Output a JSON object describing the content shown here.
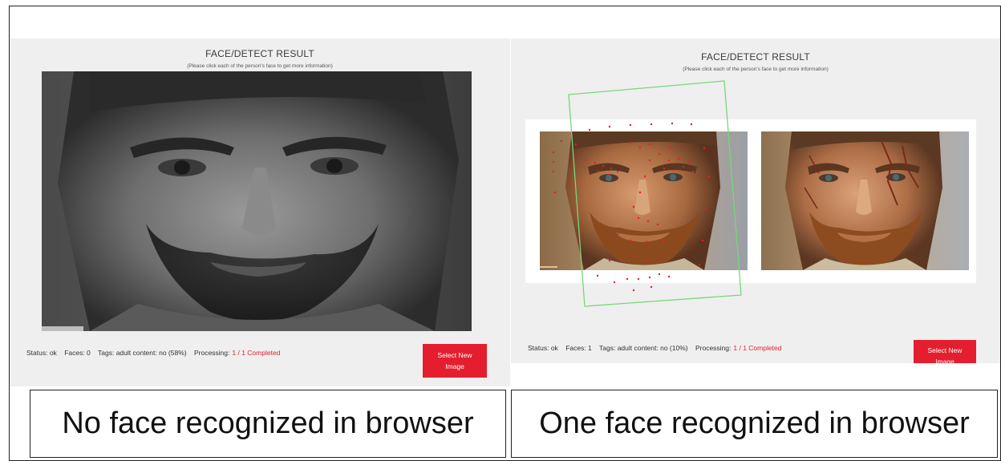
{
  "left_panel": {
    "title": "FACE/DETECT RESULT",
    "subtitle": "(Please click each of the person's face to get more information)",
    "status": "Status: ok",
    "faces": "Faces: 0",
    "tags": "Tags: adult content: no (58%)",
    "processing_label": "Processing:",
    "processing_value": "1 / 1 Completed",
    "button_label": "Select New Image"
  },
  "right_panel": {
    "title": "FACE/DETECT RESULT",
    "subtitle": "(Please click each of the person's face to get more information)",
    "status": "Status: ok",
    "faces": "Faces: 1",
    "tags": "Tags: adult content: no (10%)",
    "processing_label": "Processing:",
    "processing_value": "1 / 1 Completed",
    "button_label": "Select New Image"
  },
  "captions": {
    "left": "No face recognized in browser",
    "right": "One face recognized in browser"
  },
  "colors": {
    "accent_red": "#e41e2f",
    "face_box_green": "#7ad67a",
    "landmark_red": "#e0212f",
    "panel_bg": "#efefef"
  }
}
